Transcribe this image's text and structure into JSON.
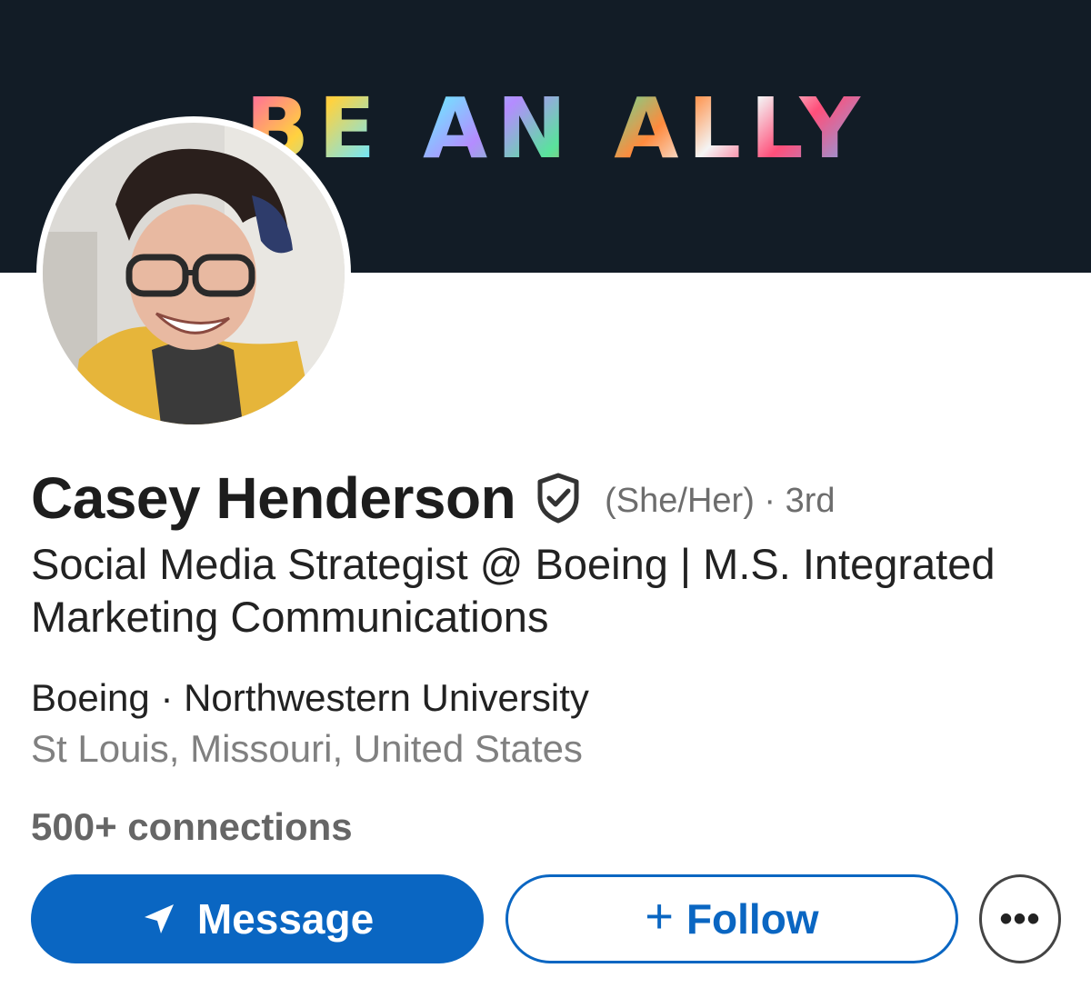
{
  "banner": {
    "text": "BE AN ALLY",
    "background": "#121c26"
  },
  "profile": {
    "name": "Casey Henderson",
    "verified_icon": "shield-check-icon",
    "pronouns_degree": "(She/Her) · 3rd",
    "headline": "Social Media Strategist @ Boeing | M.S. Integrated Marketing Communications",
    "company_school": "Boeing · Northwestern University",
    "location": "St Louis, Missouri, United States",
    "connections": "500+ connections"
  },
  "actions": {
    "message_label": "Message",
    "message_icon": "send-icon",
    "follow_plus": "+",
    "follow_label": "Follow",
    "more_label": "•••",
    "primary_color": "#0a66c2"
  }
}
